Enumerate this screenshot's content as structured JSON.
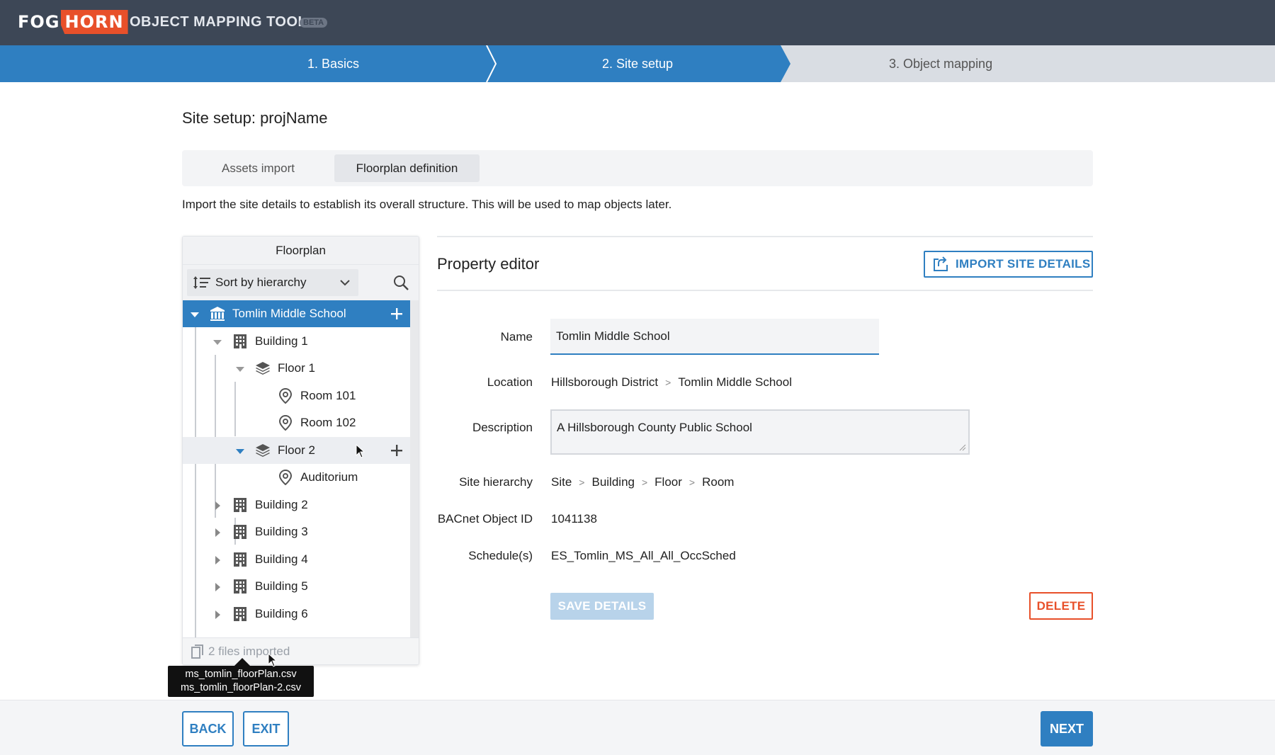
{
  "header": {
    "logo_left": "FOG",
    "logo_right": "HORN",
    "app_title": "OBJECT MAPPING TOOL",
    "badge": "BETA"
  },
  "stepper": {
    "steps": [
      {
        "label": "1. Basics",
        "state": "complete"
      },
      {
        "label": "2. Site setup",
        "state": "active"
      },
      {
        "label": "3. Object mapping",
        "state": "upcoming"
      }
    ]
  },
  "page": {
    "title": "Site setup: projName",
    "tabs": [
      {
        "label": "Assets import",
        "selected": false
      },
      {
        "label": "Floorplan definition",
        "selected": true
      }
    ],
    "intro": "Import the site details to establish its overall structure. This will be used to map objects later."
  },
  "floorplan": {
    "title": "Floorplan",
    "sort_value": "Sort by hierarchy",
    "tree": [
      {
        "label": "Tomlin Middle School",
        "type": "site",
        "level": 0,
        "expanded": true,
        "selected": true
      },
      {
        "label": "Building 1",
        "type": "building",
        "level": 1,
        "expanded": true
      },
      {
        "label": "Floor 1",
        "type": "floor",
        "level": 2,
        "expanded": true
      },
      {
        "label": "Room 101",
        "type": "room",
        "level": 3
      },
      {
        "label": "Room 102",
        "type": "room",
        "level": 3
      },
      {
        "label": "Floor 2",
        "type": "floor",
        "level": 2,
        "expanded": true,
        "hovered": true
      },
      {
        "label": "Auditorium",
        "type": "room",
        "level": 3
      },
      {
        "label": "Building 2",
        "type": "building",
        "level": 1,
        "expanded": false
      },
      {
        "label": "Building 3",
        "type": "building",
        "level": 1,
        "expanded": false
      },
      {
        "label": "Building 4",
        "type": "building",
        "level": 1,
        "expanded": false
      },
      {
        "label": "Building 5",
        "type": "building",
        "level": 1,
        "expanded": false
      },
      {
        "label": "Building 6",
        "type": "building",
        "level": 1,
        "expanded": false
      }
    ],
    "footer": "2 files imported",
    "tooltip_files": [
      "ms_tomlin_floorPlan.csv",
      "ms_tomlin_floorPlan-2.csv"
    ]
  },
  "editor": {
    "title": "Property editor",
    "import_button": "IMPORT SITE DETAILS",
    "labels": {
      "name": "Name",
      "location": "Location",
      "description": "Description",
      "hierarchy": "Site hierarchy",
      "bacnet": "BACnet Object ID",
      "schedules": "Schedule(s)"
    },
    "name_value": "Tomlin Middle School",
    "location_path": [
      "Hillsborough District",
      "Tomlin Middle School"
    ],
    "description_value": "A Hillsborough County Public School",
    "hierarchy_path": [
      "Site",
      "Building",
      "Floor",
      "Room"
    ],
    "location_separator": ">",
    "bacnet_id": "1041138",
    "schedules": "ES_Tomlin_MS_All_All_OccSched",
    "save_button": "SAVE DETAILS",
    "delete_button": "DELETE"
  },
  "footer": {
    "back": "BACK",
    "exit": "EXIT",
    "next": "NEXT"
  },
  "colors": {
    "primary": "#2f7fc1",
    "danger": "#e8502a",
    "header_bg": "#3d4756"
  }
}
